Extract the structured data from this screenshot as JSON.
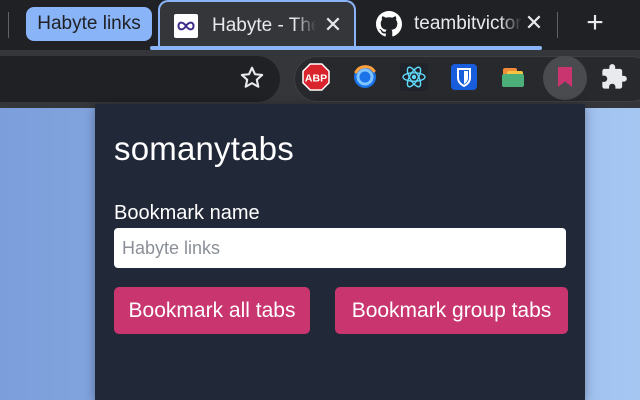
{
  "tabs": {
    "group_label": "Habyte links",
    "active_tab_title": "Habyte - The",
    "inactive_tab_title": "teambitvictor",
    "close_glyph": "✕",
    "new_tab_glyph": "+",
    "active_favicon": "habyte-infinity-icon",
    "inactive_favicon": "github-icon",
    "group_color": "#8ab4f8"
  },
  "toolbar": {
    "bookmark_star_icon": "star-icon",
    "extensions": [
      {
        "name": "adblock-plus-icon",
        "text": "ABP"
      },
      {
        "name": "firefox-relay-icon"
      },
      {
        "name": "react-devtools-icon"
      },
      {
        "name": "bitwarden-icon"
      },
      {
        "name": "folder-tabs-icon"
      },
      {
        "name": "somanytabs-bookmark-icon",
        "active": true
      },
      {
        "name": "puzzle-icon"
      }
    ]
  },
  "popup": {
    "title": "somanytabs",
    "field_label": "Bookmark name",
    "input_value": "",
    "input_placeholder": "Habyte links",
    "button_all_label": "Bookmark all tabs",
    "button_group_label": "Bookmark group tabs",
    "button_color": "#c9356f",
    "background_color": "#212838"
  }
}
